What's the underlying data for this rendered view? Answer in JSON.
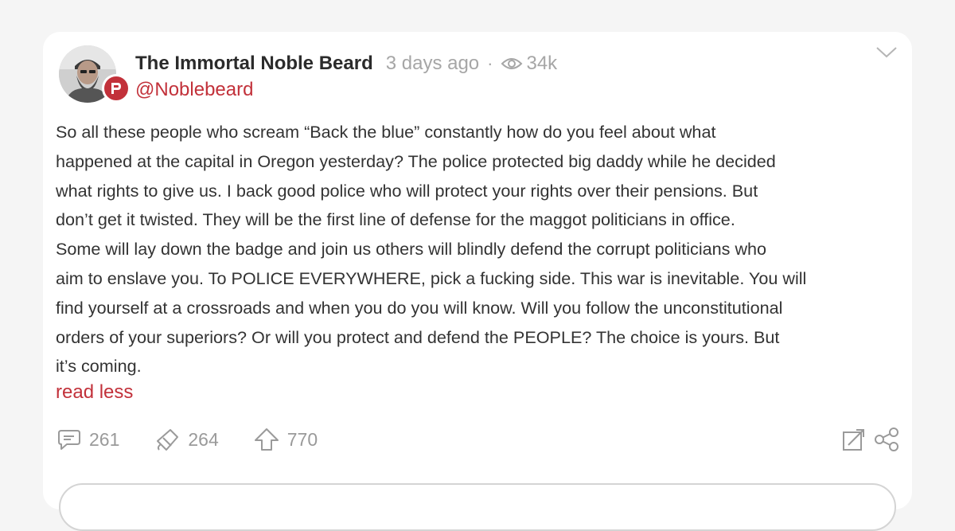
{
  "post": {
    "author": {
      "display_name": "The Immortal Noble Beard",
      "handle": "@Noblebeard",
      "avatar_icon": "user-avatar-photo",
      "badge_icon": "parler-logo-badge"
    },
    "timestamp": "3 days ago",
    "separator": "·",
    "views": "34k",
    "body_lines": [
      "So all these people who scream “Back the blue” constantly how do you feel about what",
      "happened at the capital in Oregon yesterday? The police protected big daddy while he decided",
      "what rights to give us. I back good police who will protect your rights over their pensions. But",
      "don’t get it twisted. They will be the first line of defense for the maggot politicians in office.",
      "Some will lay down the badge and join us others will blindly defend the corrupt politicians who",
      "aim to enslave you. To POLICE EVERYWHERE, pick a fucking side. This war is inevitable. You will",
      "find yourself at a crossroads and when you do you will know. Will you follow the unconstitutional",
      "orders of your superiors? Or will you protect and defend the PEOPLE? The choice is yours. But",
      "it’s coming."
    ],
    "read_less_label": "read less",
    "actions": {
      "comments": "261",
      "echoes": "264",
      "upvotes": "770"
    }
  },
  "colors": {
    "accent": "#c2313a",
    "muted": "#a6a6a6",
    "text": "#333333",
    "background": "#f5f5f5",
    "card": "#ffffff"
  },
  "icons": {
    "views": "eye-icon",
    "menu": "chevron-down-icon",
    "comments": "comment-icon",
    "echoes": "echo-megaphone-icon",
    "upvotes": "upvote-arrow-icon",
    "expand": "expand-icon",
    "share": "share-icon"
  }
}
